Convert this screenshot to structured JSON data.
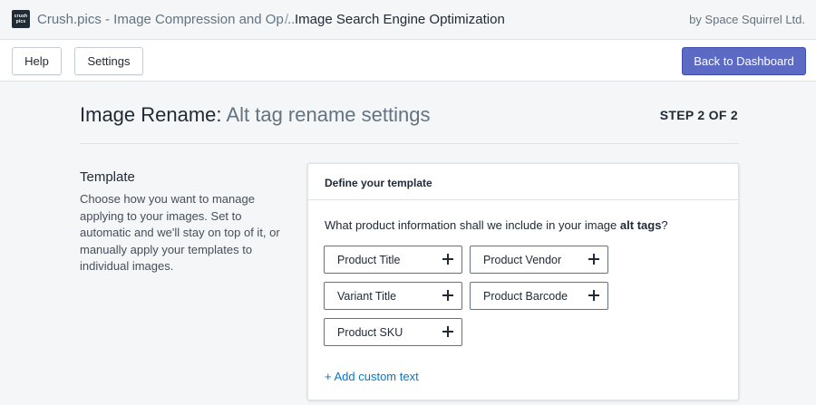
{
  "header": {
    "logo_lines": [
      "crush",
      "pics"
    ],
    "app_name": "Crush.pics - Image Compression and Op...",
    "separator": "/",
    "page_name": "Image Search Engine Optimization",
    "byline": "by Space Squirrel Ltd."
  },
  "toolbar": {
    "help_label": "Help",
    "settings_label": "Settings",
    "back_label": "Back to Dashboard",
    "primary_color": "#5c6ac4"
  },
  "page": {
    "title_main": "Image Rename:",
    "title_sub": "Alt tag rename settings",
    "step": "STEP 2 OF 2"
  },
  "section": {
    "heading": "Template",
    "description": "Choose how you want to manage applying to your images. Set to automatic and we'll stay on top of it, or manually apply your templates to individual images."
  },
  "card": {
    "title": "Define your template",
    "question_prefix": "What product information shall we include in your image",
    "question_bold": "alt tags",
    "question_suffix": "?",
    "chips": [
      "Product Title",
      "Product Vendor",
      "Variant Title",
      "Product Barcode",
      "Product SKU"
    ],
    "chip_icon": "plus-icon",
    "add_custom_text": "+ Add custom text",
    "link_color": "#007ace"
  }
}
